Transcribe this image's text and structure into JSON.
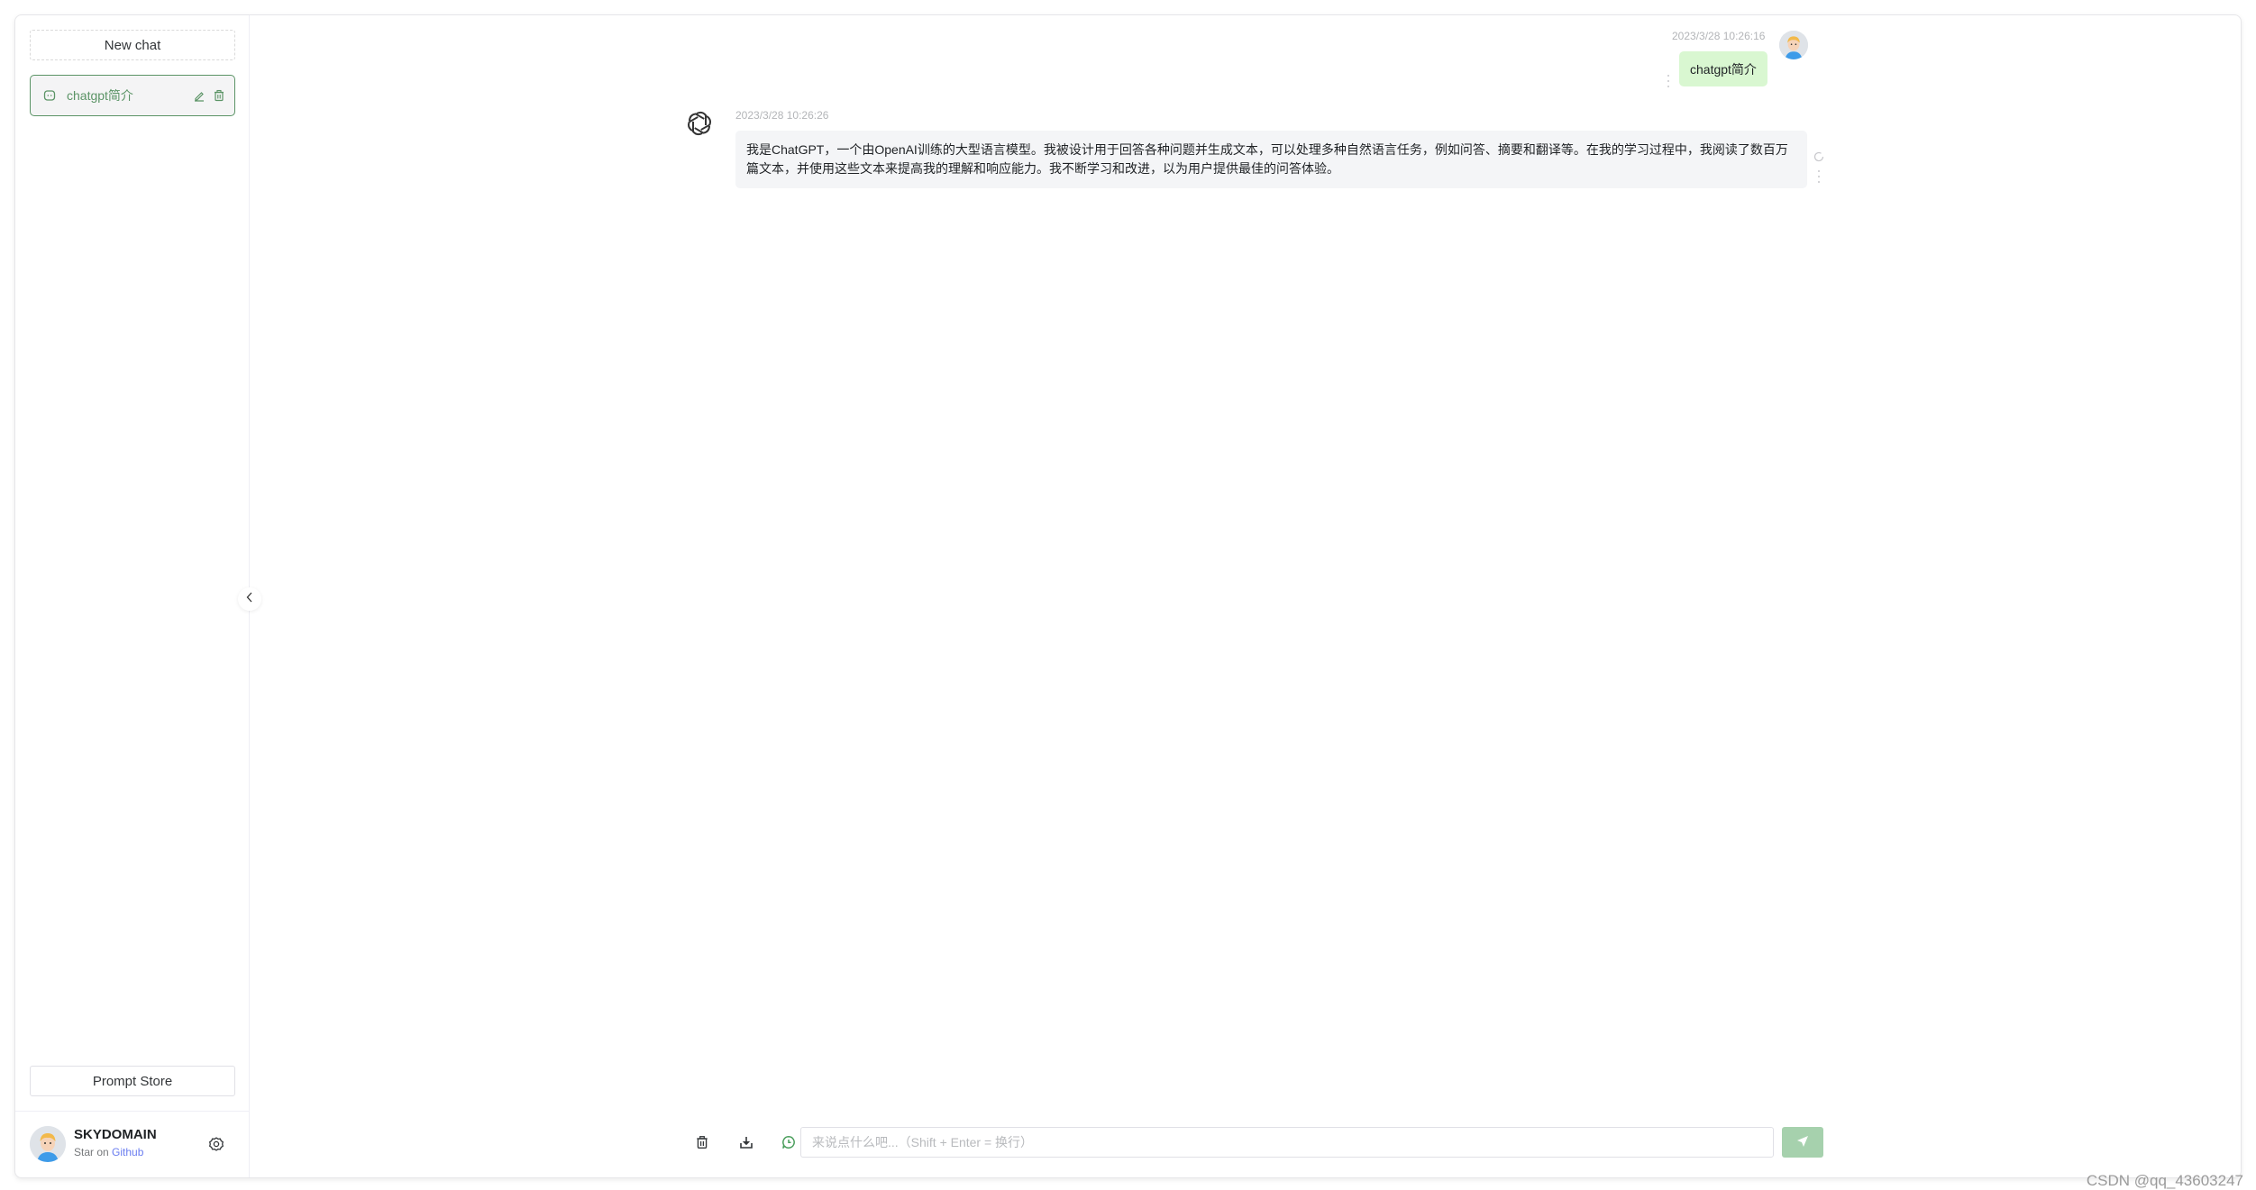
{
  "sidebar": {
    "new_chat_label": "New chat",
    "history": [
      {
        "title": "chatgpt简介",
        "active": true,
        "icons": [
          "chat-bubble-icon",
          "edit-icon",
          "delete-icon"
        ]
      }
    ],
    "prompt_store_label": "Prompt Store",
    "user": {
      "name": "SKYDOMAIN",
      "sub_prefix": "Star on",
      "sub_link": "Github"
    },
    "settings_icon": "gear-icon",
    "collapse_icon": "chevron-left-icon"
  },
  "conversation": {
    "messages": [
      {
        "role": "user",
        "timestamp": "2023/3/28 10:26:16",
        "text": "chatgpt简介"
      },
      {
        "role": "assistant",
        "timestamp": "2023/3/28 10:26:26",
        "text": "我是ChatGPT，一个由OpenAI训练的大型语言模型。我被设计用于回答各种问题并生成文本，可以处理多种自然语言任务，例如问答、摘要和翻译等。在我的学习过程中，我阅读了数百万篇文本，并使用这些文本来提高我的理解和响应能力。我不断学习和改进，以为用户提供最佳的问答体验。"
      }
    ]
  },
  "composer": {
    "tools": [
      "delete-icon",
      "download-icon",
      "context-chat-icon"
    ],
    "placeholder": "来说点什么吧...（Shift + Enter = 换行）",
    "value": "",
    "send_icon": "send-icon"
  },
  "colors": {
    "accent": "#5b9466",
    "user_bubble": "#d9f7d1",
    "assistant_bubble": "#f4f5f7",
    "send_button": "#a6d1ad",
    "link": "#6a7df0"
  },
  "watermark": "CSDN @qq_43603247"
}
